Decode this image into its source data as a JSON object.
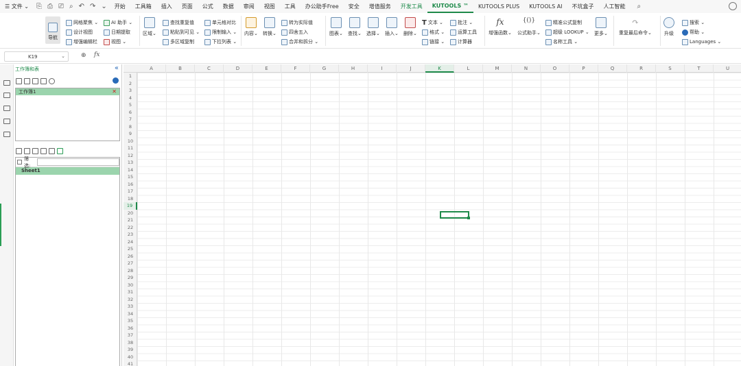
{
  "menubar": {
    "file_menu": "文件",
    "tabs": [
      "开始",
      "工具箱",
      "插入",
      "页面",
      "公式",
      "数据",
      "审阅",
      "视图",
      "工具",
      "办公助手Free",
      "安全",
      "增值服务",
      "开发工具",
      "KUTOOLS ™",
      "KUTOOLS PLUS",
      "KUTOOLS AI",
      "不坑盒子",
      "人工智能"
    ],
    "active_tab": "KUTOOLS ™"
  },
  "ribbon": {
    "nav": "导航",
    "view_group": {
      "grid_focus": "网格聚焦",
      "design_view": "设计视图",
      "wide_edit": "增强编辑栏",
      "ai_assistant": "AI 助手",
      "date_pick": "日期提取",
      "view": "视图"
    },
    "range_group": {
      "region": "区域",
      "find_dup": "查找重复值",
      "paste_visible": "粘贴到可见",
      "multi_copy": "多区域复制",
      "cell_compare": "单元格对比",
      "limit_input": "限制输入",
      "dropdown": "下拉列表"
    },
    "content_group": {
      "content": "内容",
      "convert": "转换",
      "to_actual": "转为实际值",
      "round": "四舍五入",
      "merge_split": "合并和拆分"
    },
    "edit_group": {
      "chart": "图表",
      "find": "查找",
      "select": "选择",
      "insert": "插入",
      "delete": "删除",
      "text": "文本",
      "format": "格式",
      "link": "链接",
      "comment": "批注",
      "calc_tools": "运算工具",
      "calculator": "计算器"
    },
    "formula_group": {
      "enhanced_fn": "增强函数",
      "formula_helper": "公式助手",
      "exact_copy": "精准公式复制",
      "super_lookup": "超级 LOOKUP",
      "name_tools": "名称工具",
      "more": "更多"
    },
    "redo": "重复最后命令",
    "help_group": {
      "upgrade": "升级",
      "search": "搜索",
      "help": "帮助",
      "languages": "Languages"
    }
  },
  "formula_bar": {
    "name_box": "K19"
  },
  "nav_pane": {
    "title": "工作簿和表",
    "workbook": "工作簿1",
    "filter_label": "筛选:",
    "sheet": "Sheet1"
  },
  "grid": {
    "columns": [
      "A",
      "B",
      "C",
      "D",
      "E",
      "F",
      "G",
      "H",
      "I",
      "J",
      "K",
      "L",
      "M",
      "N",
      "O",
      "P",
      "Q",
      "R",
      "S",
      "T",
      "U"
    ],
    "selected_column": "K",
    "selected_row": "19"
  }
}
